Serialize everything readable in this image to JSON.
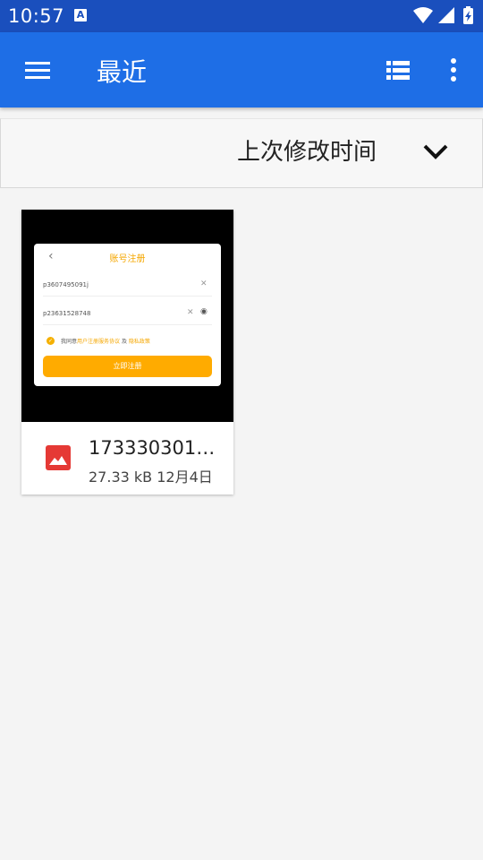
{
  "status_bar": {
    "time": "10:57",
    "notification_icon": "A",
    "icons": [
      "wifi-icon",
      "signal-icon",
      "battery-charging-icon"
    ]
  },
  "app_bar": {
    "title": "最近",
    "menu_icon": "hamburger-menu-icon",
    "view_toggle_icon": "list-view-icon",
    "overflow_icon": "more-vert-icon",
    "color": "#1e6ee6"
  },
  "sort_bar": {
    "label": "上次修改时间",
    "icon": "chevron-down-icon"
  },
  "files": [
    {
      "name": "173330301…",
      "size": "27.33 kB",
      "date": "12月4日",
      "type_icon": "image-file-icon",
      "type_color": "#e53935",
      "preview": {
        "title": "账号注册",
        "field1": "p3607495091j",
        "field2": "p23631528748",
        "agree_prefix": "我同意",
        "agree_link1": "用户注册服务协议",
        "agree_mid": " 及 ",
        "agree_link2": "隐私政策",
        "button": "立即注册"
      }
    }
  ]
}
